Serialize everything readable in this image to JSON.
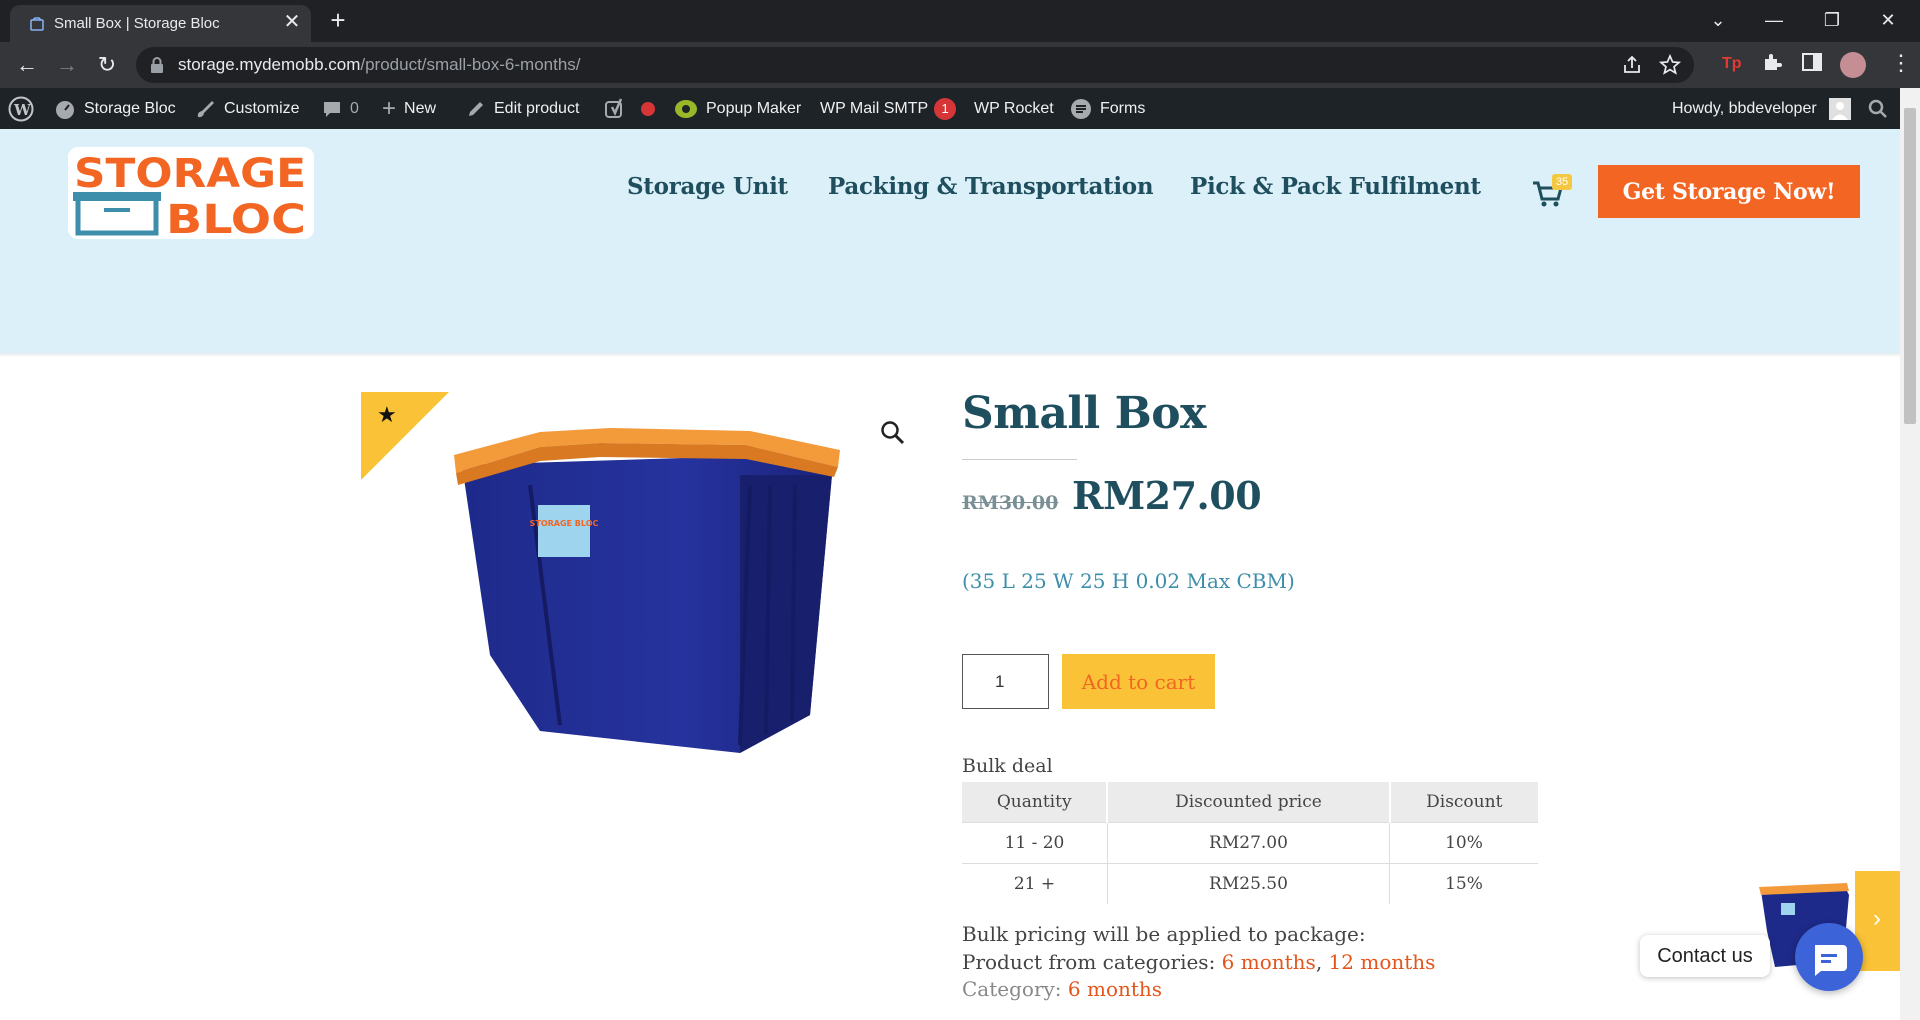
{
  "browser": {
    "tab_title": "Small Box | Storage Bloc",
    "url_host": "storage.mydemobb.com",
    "url_path": "/product/small-box-6-months/"
  },
  "admin_bar": {
    "site_name": "Storage Bloc",
    "customize": "Customize",
    "comments_count": "0",
    "new": "New",
    "edit_product": "Edit product",
    "popup_maker": "Popup Maker",
    "wp_mail_smtp": "WP Mail SMTP",
    "wp_mail_smtp_badge": "1",
    "wp_rocket": "WP Rocket",
    "forms": "Forms",
    "howdy": "Howdy, bbdeveloper"
  },
  "header": {
    "logo_line1": "STORAGE",
    "logo_line2": "BLOC",
    "nav": [
      "Storage Unit",
      "Packing & Transportation",
      "Pick & Pack Fulfilment"
    ],
    "cart_count": "35",
    "cta": "Get Storage Now!"
  },
  "product": {
    "title": "Small Box",
    "old_price": "RM30.00",
    "price": "RM27.00",
    "dimensions": "(35 L 25 W 25 H 0.02 Max CBM)",
    "quantity": "1",
    "add_to_cart": "Add to cart",
    "image_label": "STORAGE BLOC"
  },
  "bulk": {
    "title": "Bulk deal",
    "headers": [
      "Quantity",
      "Discounted price",
      "Discount"
    ],
    "rows": [
      [
        "11 - 20",
        "RM27.00",
        "10%"
      ],
      [
        "21 +",
        "RM25.50",
        "15%"
      ]
    ],
    "note": "Bulk pricing will be applied to package:",
    "categories_label": "Product from categories:",
    "categories": [
      "6 months",
      "12 months"
    ],
    "category_label": "Category:",
    "category": "6 months"
  },
  "widgets": {
    "contact": "Contact us"
  },
  "colors": {
    "brand_orange": "#f26522",
    "brand_teal": "#1f4f5f",
    "header_bg": "#dbf0f8",
    "button_yellow": "#fac337"
  }
}
